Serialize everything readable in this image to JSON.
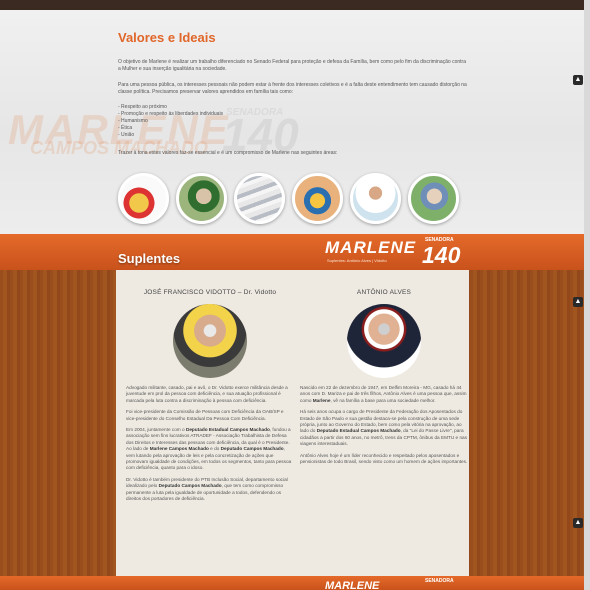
{
  "valores": {
    "title": "Valores e Ideais",
    "p1": "O objetivo de Marlene é realizar um trabalho diferenciado no Senado Federal para proteção e defesa da Família, bem como pelo fim da discriminação contra a Mulher e sua inserção igualitária na sociedade.",
    "p2": "Para uma pessoa pública, os interesses pessoais não podem estar à frente dos interesses coletivos e é a falta deste entendimento tem causado distorção na classe política. Precisamos preservar valores aprendidos em família tais como:",
    "list": [
      "- Respeito ao próximo",
      "- Promoção e respeito às liberdades individuais",
      "- Humanismo",
      "- Ética",
      "- União"
    ],
    "p3": "Trazer à tona estes valores faz-se essencial e é um compromisso de Marlene nas seguintes áreas:",
    "bg_name": "MARLENE",
    "bg_surname": "CAMPOS MACHADO",
    "bg_senadora": "SENADORA",
    "bg_number": "140"
  },
  "suplentes": {
    "title": "Suplentes",
    "logo_name": "MARLENE",
    "logo_senadora": "SENADORA",
    "logo_number": "140",
    "logo_sub": "Suplentes: Antônio Alves | Vidotto",
    "left": {
      "name": "JOSÉ FRANCISCO VIDOTTO – Dr. Vidotto",
      "paragraphs": [
        "Advogado militante, casado, pai e avô, o Dr. Vidotto exerce militância desde a juventude em prol da pessoa com deficiência, e sua atuação profissional é marcada pela luta contra a discriminação à pessoa com deficiência.",
        "Foi vice-presidente da Comissão de Pessoas com Deficiência da OAB/SP e vice-presidente do Conselho Estadual Da Pessoa Com Deficiência.",
        "Em 2004, juntamente com o Deputado Estadual Campos Machado, fundou a associação sem fins lucrativos ATRADEF - Associação Trabalhista de Defesa dos Direitos e Interesses das pessoas com deficiência, da qual é o Presidente. Ao lado de Marlene Campos Machado e do Deputado Campos Machado, vem lutando pela aprovação de leis e pela concretização de ações que promovam igualdade de condições, em todos os segmentos, tanto para pessoa com deficiência, quanto para o idoso.",
        "Dr. Vidotto é também presidente do PTB Inclusão Social, departamento social idealizado pelo Deputado Campos Machado, que tem como compromisso permanente a luta pela igualdade de oportunidade a todos, defendendo os direitos dos portadores de deficiência."
      ]
    },
    "right": {
      "name": "ANTÔNIO ALVES",
      "paragraphs": [
        "Nascido em 22 de dezembro de 1947, em Delfim Moreira - MG, casado há 44 anos com D. Mariza e pai de três filhos, Antônio Alves é uma pessoa que, assim como Marlene, vê na família a base para uma sociedade melhor.",
        "Há seis anos ocupa o cargo de Presidente da Federação dos Aposentados do Estado de São Paulo e sua gestão destaca-se pela construção de uma sede própria, junto ao Governo do Estado, bem como pela vitória na aprovação, ao lado do Deputado Estadual Campos Machado, da \"Lei do Passe Livre\", para cidadãos a partir dos 60 anos, no metrô, trens da CPTM, ônibus da EMTU e nas viagens interestaduais.",
        "Antônio Alves hoje é um líder reconhecido e respeitado pelos aposentados e pensionistas de todo Brasil, sendo visto como um homem de ações importantes."
      ]
    }
  },
  "colors": {
    "accent": "#e0662a",
    "bar": "#d65d22",
    "wood": "#9a4e1e"
  },
  "icons": {
    "scroll_up": "chevron-up-icon"
  }
}
